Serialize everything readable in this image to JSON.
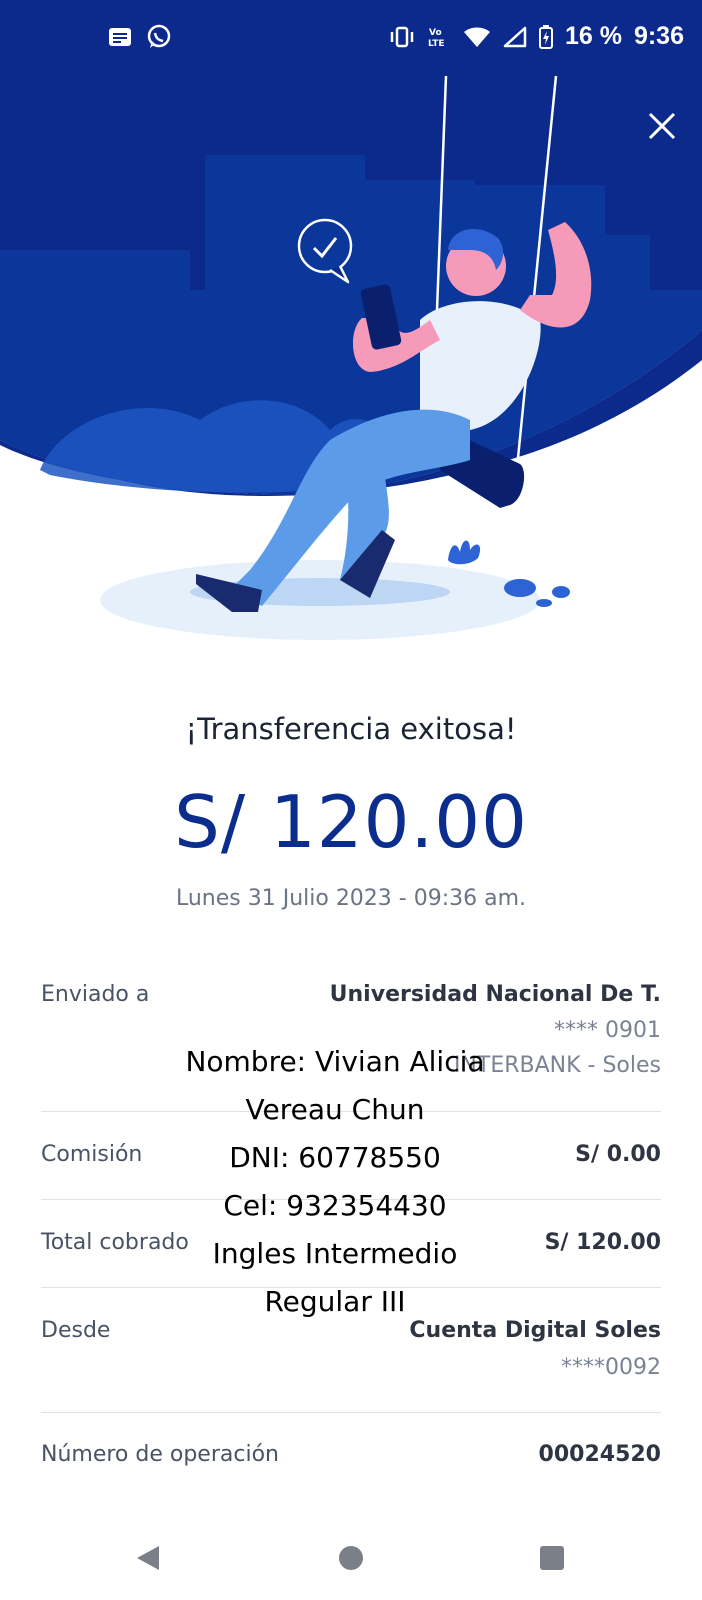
{
  "status_bar": {
    "battery": "16 %",
    "time": "9:36",
    "network": "LTE",
    "left_icons": [
      "message-icon",
      "whatsapp-icon"
    ],
    "right_icons": [
      "vibrate-icon",
      "volte-icon",
      "wifi-icon",
      "signal-icon",
      "battery-icon"
    ]
  },
  "colors": {
    "hero_blue": "#0b2a8c",
    "amount_blue": "#0b2e8e",
    "skin_pink": "#f59ab8",
    "pants_blue": "#5b9be8"
  },
  "success": {
    "title": "¡Transferencia exitosa!",
    "amount": "S/ 120.00",
    "datetime": "Lunes 31 Julio 2023 - 09:36 am."
  },
  "details": {
    "sent_to": {
      "label": "Enviado a",
      "value": "Universidad Nacional De T.",
      "account": "**** 0901",
      "bank": "INTERBANK - Soles"
    },
    "commission": {
      "label": "Comisión",
      "value": "S/ 0.00"
    },
    "total": {
      "label": "Total cobrado",
      "value": "S/ 120.00"
    },
    "from": {
      "label": "Desde",
      "value": "Cuenta Digital Soles",
      "account": "****0092"
    },
    "operation": {
      "label": "Número de operación",
      "value": "00024520"
    }
  },
  "overlay_note": {
    "line1": "Nombre: Vivian Alicia",
    "line2": "Vereau Chun",
    "line3": "DNI: 60778550",
    "line4": "Cel: 932354430",
    "line5": "Ingles Intermedio",
    "line6": "Regular III"
  },
  "navigation": [
    "back-icon",
    "home-icon",
    "recents-icon"
  ]
}
